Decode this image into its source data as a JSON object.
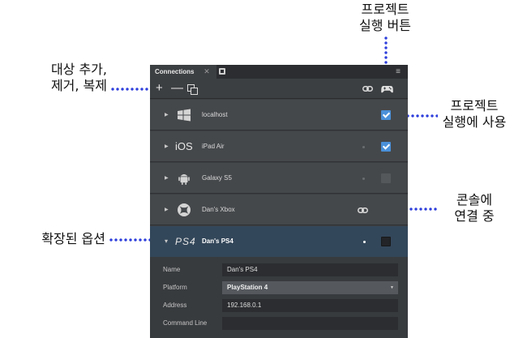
{
  "annotations": {
    "top": "프로젝트\n실행 버튼",
    "top_line1": "프로젝트",
    "top_line2": "실행 버튼",
    "left_1_line1": "대상 추가,",
    "left_1_line2": "제거, 복제",
    "right_1_line1": "프로젝트",
    "right_1_line2": "실행에 사용",
    "right_2_line1": "콘솔에",
    "right_2_line2": "연결 중",
    "left_2": "확장된 옵션"
  },
  "panel": {
    "tab_label": "Connections",
    "tab_close": "✕",
    "menu_icon": "≡",
    "toolbar": {
      "add": "+",
      "remove": "—",
      "duplicate_icon": "duplicate-icon",
      "link_icon": "link-icon",
      "play_icon": "gamepad-icon"
    }
  },
  "targets": [
    {
      "label": "localhost",
      "icon": "windows-icon",
      "run": true,
      "state": "checked"
    },
    {
      "label": "iPad Air",
      "icon": "iOS",
      "run": true,
      "state": "checked"
    },
    {
      "label": "Galaxy S5",
      "icon": "android-icon",
      "run": false,
      "state": "disabled"
    },
    {
      "label": "Dan's Xbox",
      "icon": "xbox-icon",
      "connected": true
    },
    {
      "label": "Dan's PS4",
      "icon": "PS4",
      "expanded": true,
      "run": false,
      "state": "unchecked"
    }
  ],
  "options": {
    "name_label": "Name",
    "name_value": "Dan's PS4",
    "platform_label": "Platform",
    "platform_value": "PlayStation 4",
    "address_label": "Address",
    "address_value": "192.168.0.1",
    "cmd_label": "Command Line",
    "cmd_value": ""
  },
  "colors": {
    "panel_bg": "#3c3f42",
    "row_bg": "#45484b",
    "expanded_bg": "#33475a",
    "checkbox_on": "#4a90d9",
    "callout_dots": "#2d3edb"
  }
}
